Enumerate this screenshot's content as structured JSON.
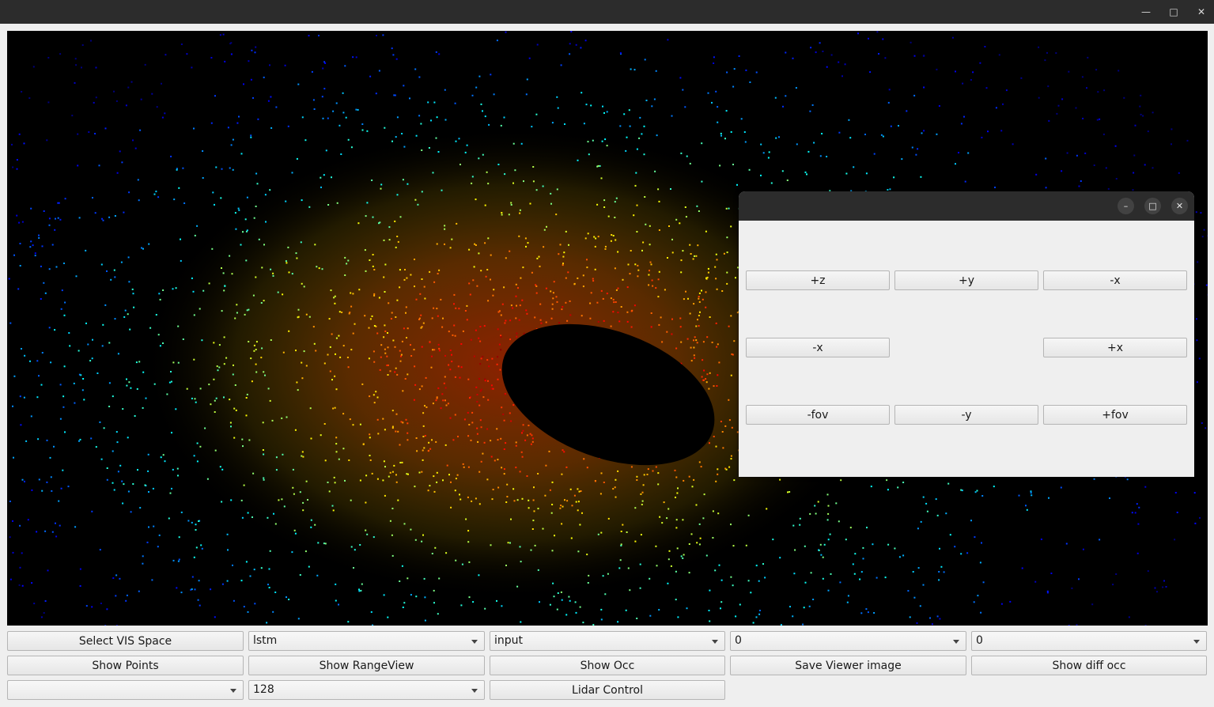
{
  "window": {
    "controls": {
      "minimize_icon": "minimize-icon",
      "maximize_icon": "maximize-icon",
      "close_icon": "close-icon"
    }
  },
  "viewer": {
    "content": "lidar point cloud visualization",
    "background": "#000000"
  },
  "lidar_dialog": {
    "buttons": {
      "plus_z": "+z",
      "plus_y": "+y",
      "minus_x_top": "-x",
      "minus_x": "-x",
      "plus_x": "+x",
      "minus_fov": "-fov",
      "minus_y": "-y",
      "plus_fov": "+fov"
    }
  },
  "controls": {
    "row1": {
      "select_vis_space": "Select VIS Space",
      "model_combo": "lstm",
      "source_combo": "input",
      "index_combo_1": "0",
      "index_combo_2": "0"
    },
    "row2": {
      "show_points": "Show Points",
      "show_rangeview": "Show RangeView",
      "show_occ": "Show Occ",
      "save_viewer_image": "Save Viewer image",
      "show_diff_occ": "Show diff occ"
    },
    "row3": {
      "empty_combo": "",
      "resolution_combo": "128",
      "lidar_control": "Lidar Control"
    }
  }
}
